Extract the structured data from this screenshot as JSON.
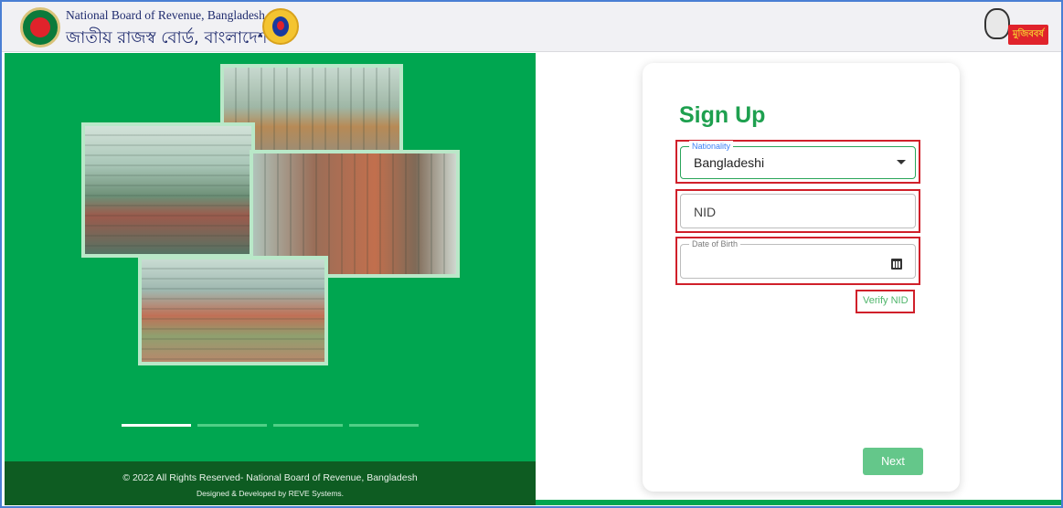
{
  "header": {
    "org_name_en": "National Board of Revenue, Bangladesh",
    "org_name_bn": "জাতীয় রাজস্ব বোর্ড, বাংলাদেশ",
    "mujib_badge": "মুজিববর্ষ"
  },
  "carousel": {
    "slides": 4,
    "active_index": 0
  },
  "footer": {
    "copyright": "© 2022 All Rights Reserved- National Board of Revenue, Bangladesh",
    "credits": "Designed & Developed by REVE Systems."
  },
  "signup": {
    "title": "Sign Up",
    "nationality": {
      "label": "Nationality",
      "value": "Bangladeshi"
    },
    "nid": {
      "placeholder": "NID"
    },
    "dob": {
      "label": "Date of Birth",
      "value": ""
    },
    "verify_label": "Verify NID",
    "next_label": "Next"
  },
  "colors": {
    "brand_green": "#00a650",
    "title_green": "#1ea04f",
    "highlight_red": "#d0202a",
    "footer_dark": "#0e5c22"
  }
}
